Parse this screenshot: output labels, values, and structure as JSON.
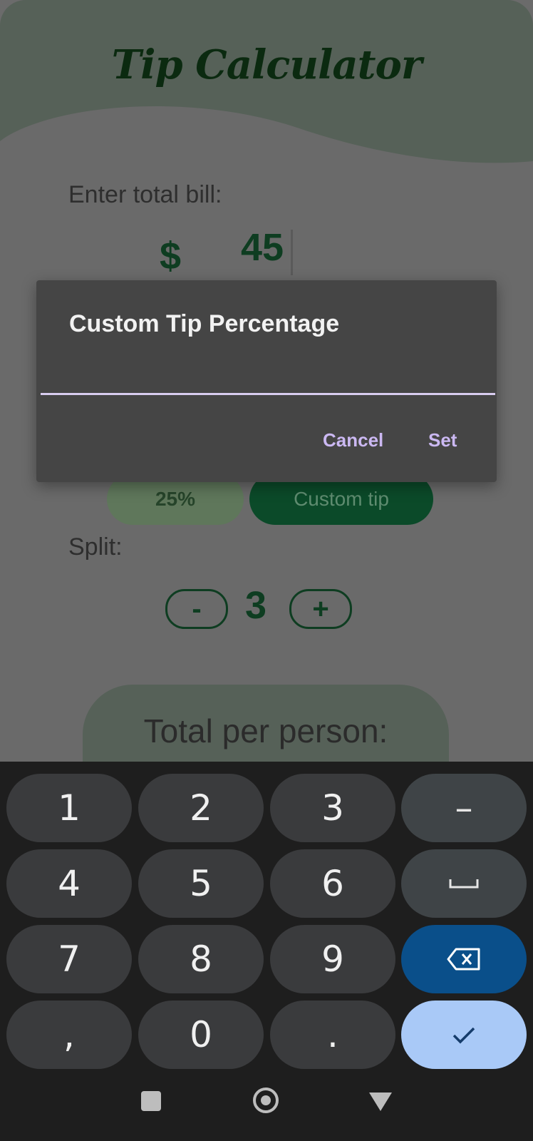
{
  "app": {
    "title": "Tip Calculator",
    "bill_label": "Enter total bill:",
    "currency_symbol": "$",
    "bill_value": "45",
    "tip_options": [
      {
        "label": "25%"
      },
      {
        "label": "Custom tip"
      }
    ],
    "split_label": "Split:",
    "split_minus": "-",
    "split_plus": "+",
    "split_value": "3",
    "total_label": "Total per person:"
  },
  "dialog": {
    "title": "Custom Tip Percentage",
    "input_value": "",
    "cancel_label": "Cancel",
    "set_label": "Set"
  },
  "keyboard": {
    "keys": [
      "1",
      "2",
      "3",
      "–",
      "4",
      "5",
      "6",
      "␣",
      "7",
      "8",
      "9",
      "⌫",
      ",",
      "0",
      ".",
      "✓"
    ]
  },
  "navbar": {
    "icons": [
      "recents-square-icon",
      "home-circle-icon",
      "back-triangle-icon"
    ]
  },
  "colors": {
    "header": "#566158",
    "primary_dark_green": "#0e3d21",
    "dialog_bg": "#454545",
    "dialog_accent": "#cbb8f2",
    "keyboard_bg": "#1e1e1e",
    "backspace_key": "#0a4f8a",
    "enter_key": "#a9c9f7"
  }
}
